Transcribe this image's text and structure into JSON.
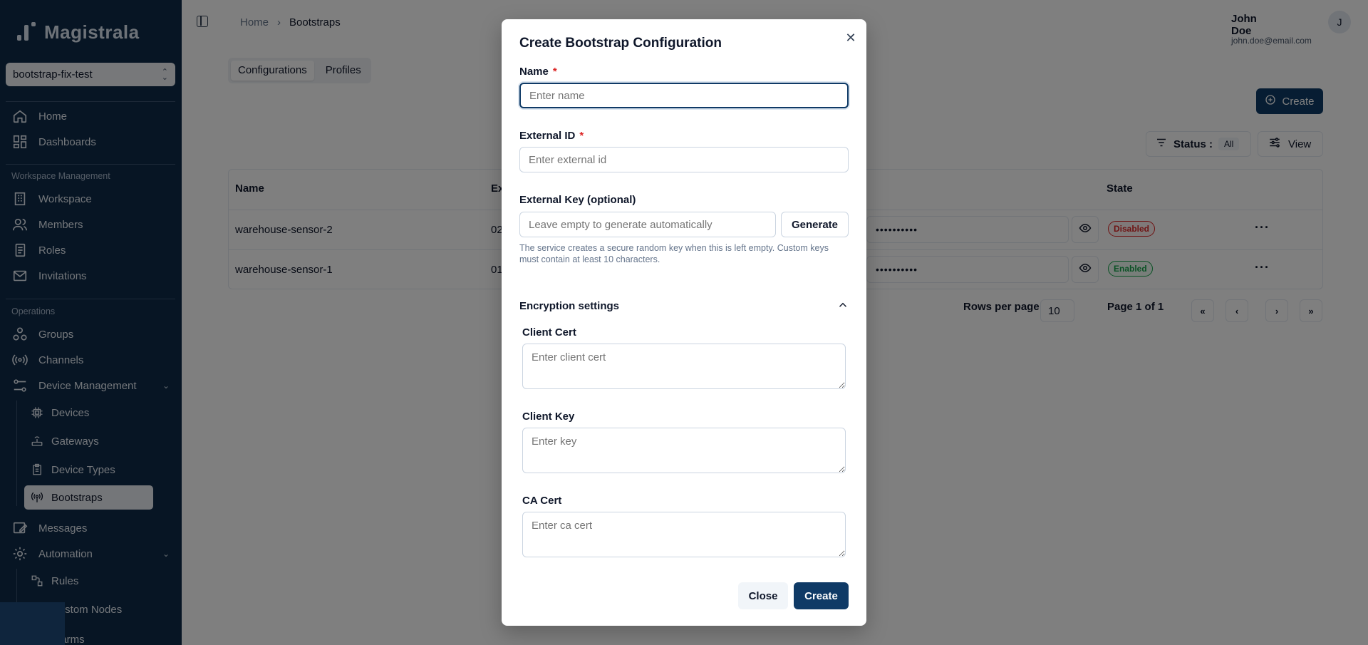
{
  "app": {
    "brand": "Magistrala"
  },
  "workspace_select": {
    "value": "bootstrap-fix-test"
  },
  "sidebar": {
    "home": "Home",
    "dashboards": "Dashboards",
    "section_workspace": "Workspace Management",
    "workspace": "Workspace",
    "members": "Members",
    "roles": "Roles",
    "invitations": "Invitations",
    "section_operations": "Operations",
    "groups": "Groups",
    "channels": "Channels",
    "device_management": "Device Management",
    "devices": "Devices",
    "gateways": "Gateways",
    "device_types": "Device Types",
    "bootstraps": "Bootstraps",
    "messages": "Messages",
    "automation": "Automation",
    "rules": "Rules",
    "custom_nodes": "Custom Nodes",
    "alarms": "Alarms"
  },
  "breadcrumb": {
    "home": "Home",
    "current": "Bootstraps"
  },
  "user": {
    "name": "John Doe",
    "email": "john.doe@email.com",
    "initial": "J"
  },
  "tabs": {
    "configurations": "Configurations",
    "profiles": "Profiles"
  },
  "toolbar": {
    "create": "Create",
    "status_label": "Status :",
    "status_value": "All",
    "view": "View"
  },
  "table": {
    "headers": {
      "name": "Name",
      "external_id": "Ex",
      "state": "State"
    },
    "rows": [
      {
        "name": "warehouse-sensor-2",
        "external_id": "02",
        "key_masked": "••••••••••",
        "state": "Disabled"
      },
      {
        "name": "warehouse-sensor-1",
        "external_id": "01",
        "key_masked": "••••••••••",
        "state": "Enabled"
      }
    ]
  },
  "pagination": {
    "rows_per_page_label": "Rows per page",
    "rows_per_page": "10",
    "page_info": "Page 1 of 1"
  },
  "dialog": {
    "title": "Create Bootstrap Configuration",
    "name_label": "Name",
    "name_placeholder": "Enter name",
    "external_id_label": "External ID",
    "external_id_placeholder": "Enter external id",
    "external_key_label": "External Key (optional)",
    "external_key_placeholder": "Leave empty to generate automatically",
    "generate": "Generate",
    "help_text": "The service creates a secure random key when this is left empty. Custom keys must contain at least 10 characters.",
    "encryption_section": "Encryption settings",
    "client_cert_label": "Client Cert",
    "client_cert_placeholder": "Enter client cert",
    "client_key_label": "Client Key",
    "client_key_placeholder": "Enter key",
    "ca_cert_label": "CA Cert",
    "ca_cert_placeholder": "Enter ca cert",
    "close": "Close",
    "create": "Create",
    "required_mark": "*"
  },
  "colors": {
    "sidebar_bg": "#0f2a48",
    "primary": "#0f3a66",
    "danger": "#dc2626",
    "success": "#16a34a"
  }
}
